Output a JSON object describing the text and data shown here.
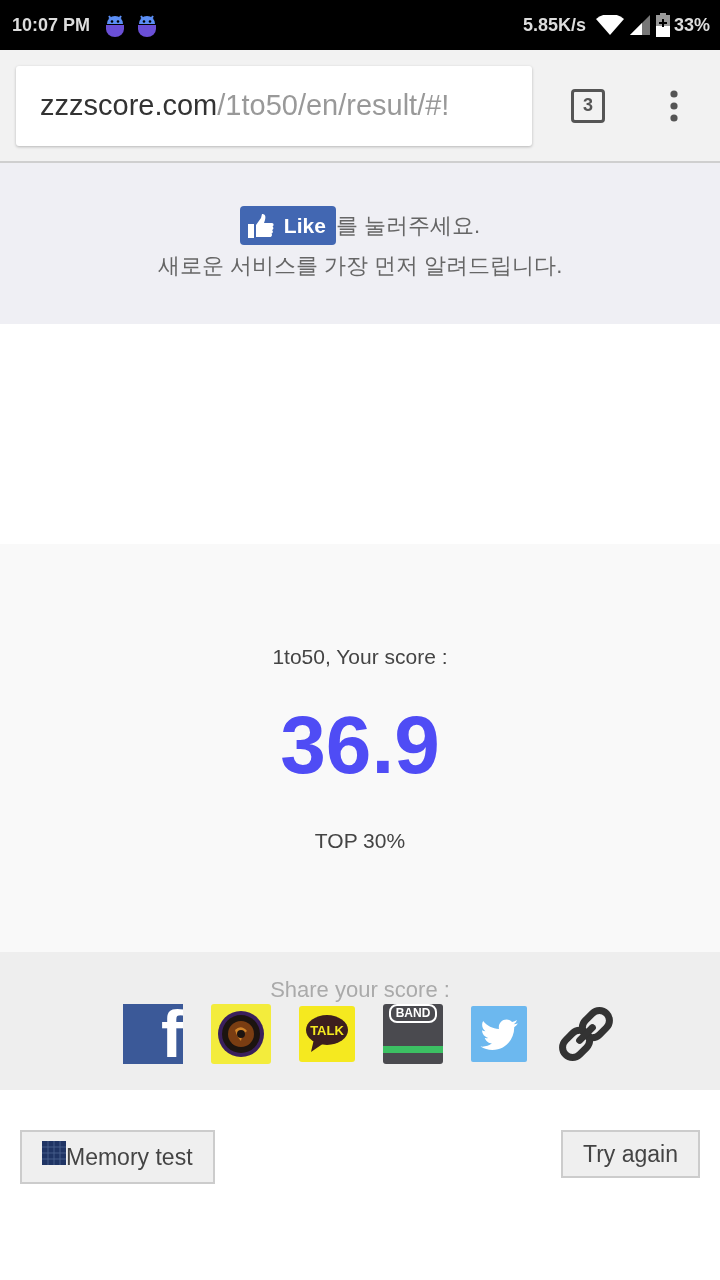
{
  "status_bar": {
    "time": "10:07 PM",
    "network_speed": "5.85K/s",
    "battery": "33%"
  },
  "browser": {
    "url_host": "zzzscore.com",
    "url_path": "/1to50/en/result/#!",
    "tab_count": "3"
  },
  "like_banner": {
    "like_button": "Like",
    "line_1": "를 눌러주세요.",
    "line_2": "새로운 서비스를 가장 먼저 알려드립니다."
  },
  "score_panel": {
    "caption": "1to50, Your score :",
    "score": "36.9",
    "rank": "TOP 30%"
  },
  "share": {
    "title": "Share your score :",
    "buttons": [
      {
        "kind": "letter",
        "label": "f"
      },
      {
        "kind": "lens"
      },
      {
        "kind": "bubble",
        "label": "TALK"
      },
      {
        "kind": "band",
        "label": "BAND"
      },
      {
        "kind": "bird"
      },
      {
        "kind": "chain"
      }
    ]
  },
  "actions": [
    {
      "kind": "grid",
      "label": "Memory test"
    },
    {
      "kind": "plain",
      "label": "Try again"
    }
  ]
}
